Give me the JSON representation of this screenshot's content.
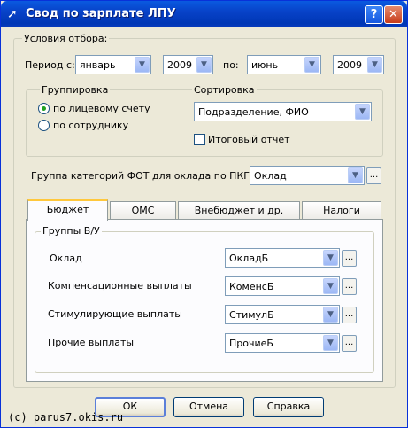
{
  "window": {
    "title": "Свод по зарплате ЛПУ",
    "help": "?",
    "close": "✕"
  },
  "selection": {
    "legend": "Условия отбора:",
    "period_label": "Период с:",
    "from_month": "январь",
    "from_year": "2009",
    "to_label": "по:",
    "to_month": "июнь",
    "to_year": "2009"
  },
  "grouping": {
    "legend": "Группировка",
    "options": [
      "по лицевому счету",
      "по сотруднику"
    ],
    "selected": 0
  },
  "sorting": {
    "legend": "Сортировка",
    "value": "Подразделение, ФИО",
    "total_report_label": "Итоговый отчет",
    "total_report_checked": false
  },
  "fot_group": {
    "label": "Группа категорий ФОТ для оклада по ПКГ",
    "value": "Оклад"
  },
  "tabs": [
    "Бюджет",
    "ОМС",
    "Внебюджет и др.",
    "Налоги"
  ],
  "active_tab": "Бюджет",
  "groups": {
    "legend": "Группы В/У",
    "rows": [
      {
        "label": "Оклад",
        "value": "ОкладБ"
      },
      {
        "label": "Компенсационные выплаты",
        "value": "КоменсБ"
      },
      {
        "label": "Стимулирующие выплаты",
        "value": "СтимулБ"
      },
      {
        "label": "Прочие выплаты",
        "value": "ПрочиеБ"
      }
    ]
  },
  "buttons": {
    "ok": "ОК",
    "cancel": "Отмена",
    "help": "Справка"
  },
  "watermark": "(c) parus7.okis.ru",
  "icons": {
    "dropdown": "▼",
    "ellipsis": "..."
  }
}
